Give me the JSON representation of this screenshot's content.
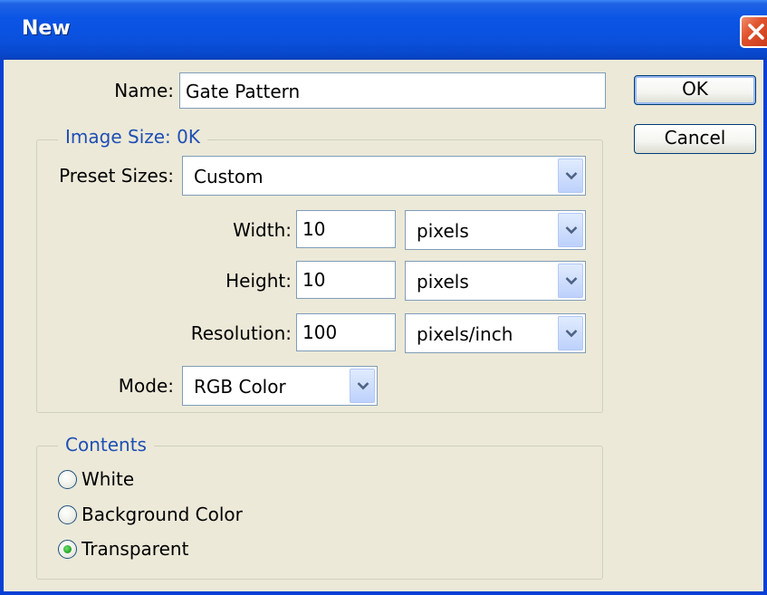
{
  "window": {
    "title": "New"
  },
  "name": {
    "label": "Name:",
    "value": "Gate Pattern"
  },
  "buttons": {
    "ok": "OK",
    "cancel": "Cancel"
  },
  "image_size": {
    "group_label": "Image Size: 0K",
    "preset": {
      "label": "Preset Sizes:",
      "value": "Custom"
    },
    "width": {
      "label": "Width:",
      "value": "10",
      "unit": "pixels"
    },
    "height": {
      "label": "Height:",
      "value": "10",
      "unit": "pixels"
    },
    "resolution": {
      "label": "Resolution:",
      "value": "100",
      "unit": "pixels/inch"
    },
    "mode": {
      "label": "Mode:",
      "value": "RGB Color"
    }
  },
  "contents": {
    "group_label": "Contents",
    "options": [
      {
        "label": "White",
        "selected": false
      },
      {
        "label": "Background Color",
        "selected": false
      },
      {
        "label": "Transparent",
        "selected": true
      }
    ]
  },
  "colors": {
    "title_bar": "#0a50dc",
    "face": "#ece9d8",
    "group_title": "#1f4fb5",
    "close_button": "#e0522c"
  }
}
